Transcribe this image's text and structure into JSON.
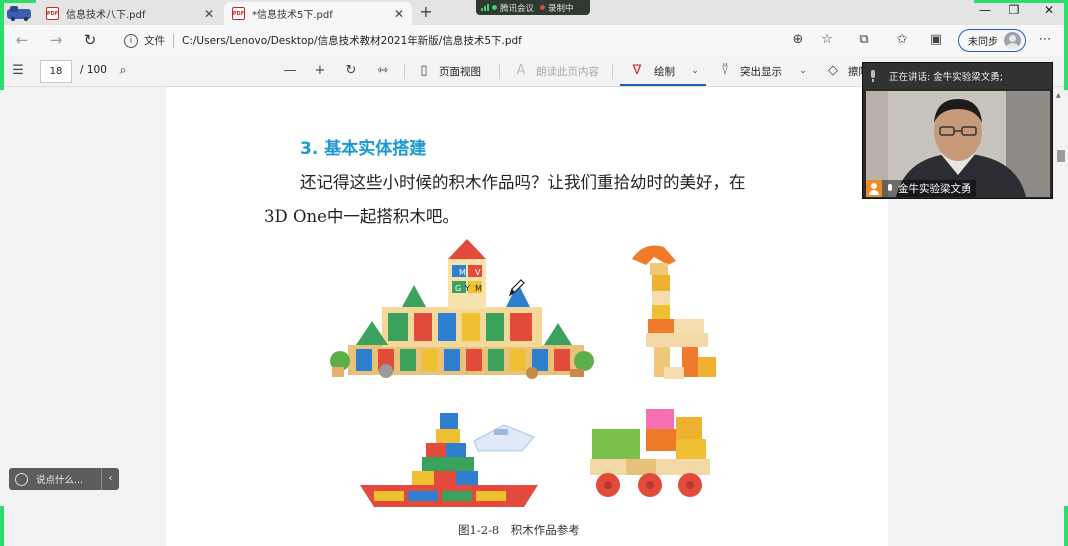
{
  "browser": {
    "tabs": [
      {
        "title": "信息技术八下.pdf",
        "icon": "pdf-file-icon",
        "active": false
      },
      {
        "title": "*信息技术5下.pdf",
        "icon": "pdf-file-icon",
        "active": true
      }
    ],
    "new_tab_icon": "plus-icon",
    "address": {
      "info_label": "文件",
      "url": "C:/Users/Lenovo/Desktop/信息技术教材2021年新版/信息技术5下.pdf"
    },
    "sync_label": "未同步"
  },
  "meeting": {
    "app_name": "腾讯会议",
    "recording_label": "录制中",
    "speaking_text": "正在讲话: 金牛实验梁文勇;",
    "participant_name": "金牛实验梁文勇",
    "chat_placeholder": "说点什么..."
  },
  "pdf_toolbar": {
    "page_current": "18",
    "page_total": "/ 100",
    "page_view_label": "页面视图",
    "read_aloud_label": "朗读此页内容",
    "draw_label": "绘制",
    "highlight_label": "突出显示",
    "erase_label": "擦除"
  },
  "document": {
    "heading": "3. 基本实体搭建",
    "paragraph_line1": "还记得这些小时候的积木作品吗？让我们重拾幼时的美好，在",
    "paragraph_line2": "3D One中一起搭积木吧。",
    "figure_caption": "图1-2-8　积木作品参考",
    "block_letters": [
      "M",
      "V",
      "G",
      "Y",
      "M"
    ]
  },
  "colors": {
    "heading_blue": "#1b9ad2",
    "accent_blue": "#1a63b5",
    "recording_green": "#2ddc6c",
    "pdf_red": "#c62828"
  }
}
